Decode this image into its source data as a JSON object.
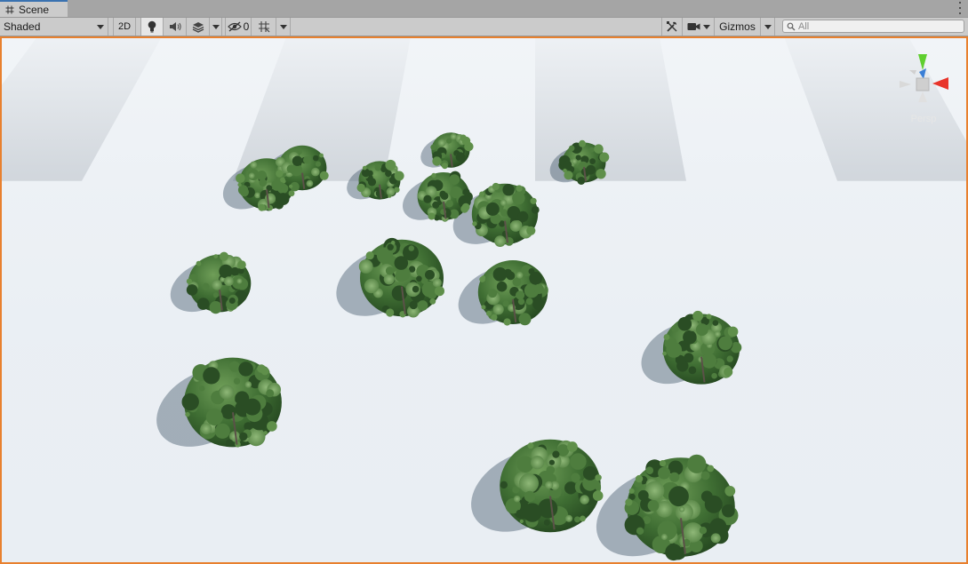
{
  "tabs": [
    {
      "label": "Scene",
      "icon": "hash-icon",
      "active": true
    }
  ],
  "toolbar": {
    "shading_mode": "Shaded",
    "mode_2d_label": "2D",
    "hidden_count": "0",
    "gizmos_label": "Gizmos",
    "search_placeholder": "All",
    "icons": [
      "lightbulb-icon",
      "speaker-icon",
      "effects-layers-icon",
      "eye-slash-icon",
      "grid-icon",
      "tools-icon",
      "camera-icon",
      "search-icon"
    ]
  },
  "viewport": {
    "selected_border_color": "#e8802e",
    "gizmo_label": "Persp"
  },
  "colors": {
    "accent_tab": "#3a72b0",
    "gizmo_x": "#e8342a",
    "gizmo_y": "#5fcf2f",
    "gizmo_z": "#3a7fd6"
  }
}
